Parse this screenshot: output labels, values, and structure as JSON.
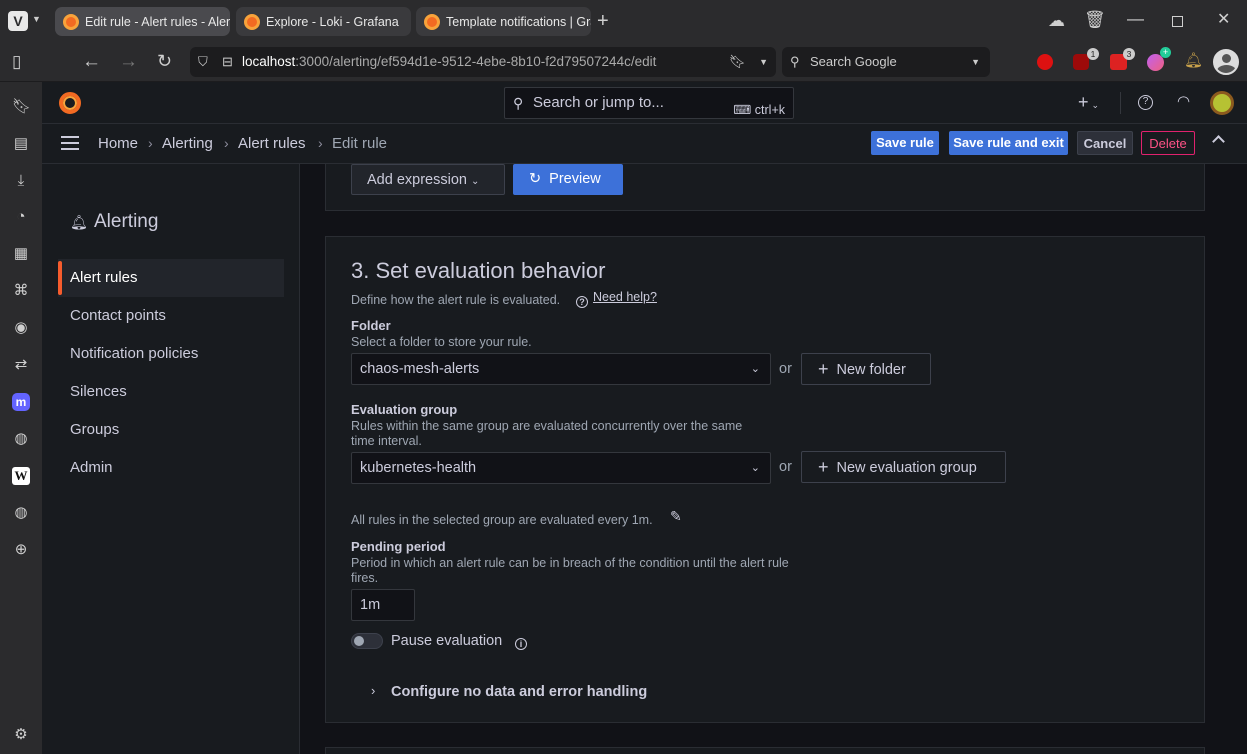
{
  "browser": {
    "tabs": [
      {
        "title": "Edit rule - Alert rules - Alert"
      },
      {
        "title": "Explore - Loki - Grafana"
      },
      {
        "title": "Template notifications | Gra"
      }
    ],
    "url_host": "localhost",
    "url_path": ":3000/alerting/ef594d1e-9512-4ebe-8b10-f2d79507244c/edit",
    "search_placeholder": "Search Google",
    "badges": {
      "ublock": "1",
      "ext2": "3"
    }
  },
  "grafana": {
    "search_placeholder": "Search or jump to...",
    "search_shortcut": "ctrl+k",
    "breadcrumb": [
      "Home",
      "Alerting",
      "Alert rules",
      "Edit rule"
    ],
    "actions": {
      "save_rule": "Save rule",
      "save_exit": "Save rule and exit",
      "cancel": "Cancel",
      "delete": "Delete"
    },
    "menu": {
      "title": "Alerting",
      "items": [
        {
          "label": "Alert rules",
          "active": true
        },
        {
          "label": "Contact points"
        },
        {
          "label": "Notification policies"
        },
        {
          "label": "Silences"
        },
        {
          "label": "Groups"
        },
        {
          "label": "Admin"
        }
      ]
    },
    "expression_card": {
      "add_expression": "Add expression",
      "preview": "Preview"
    },
    "section3": {
      "title": "3. Set evaluation behavior",
      "subtitle": "Define how the alert rule is evaluated.",
      "help": "Need help?",
      "folder_label": "Folder",
      "folder_desc": "Select a folder to store your rule.",
      "folder_value": "chaos-mesh-alerts",
      "or": "or",
      "new_folder": "New folder",
      "group_label": "Evaluation group",
      "group_desc_1": "Rules within the same group are evaluated concurrently over the same",
      "group_desc_2": "time interval.",
      "group_value": "kubernetes-health",
      "new_group": "New evaluation group",
      "eval_note": "All rules in the selected group are evaluated every 1m.",
      "pending_label": "Pending period",
      "pending_desc_1": "Period in which an alert rule can be in breach of the condition until the alert rule",
      "pending_desc_2": "fires.",
      "pending_value": "1m",
      "pause_label": "Pause evaluation",
      "no_data": "Configure no data and error handling"
    }
  },
  "colors": {
    "primary": "#3d71d9",
    "danger": "#e0226e",
    "accent": "#f65c2d"
  }
}
